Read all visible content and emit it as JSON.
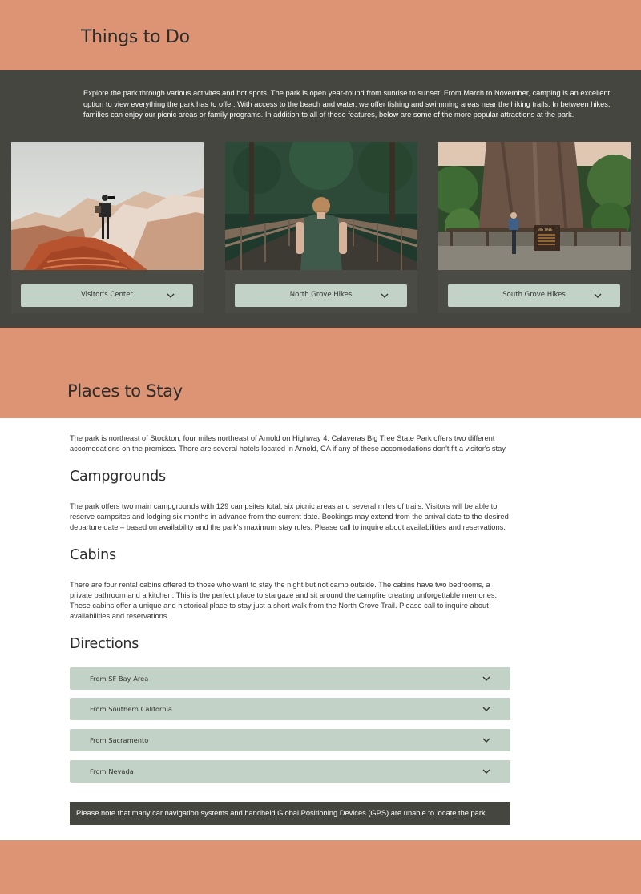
{
  "things": {
    "title": "Things to Do",
    "intro": "Explore the park through various activites and hot spots. The park is open year-round from sunrise to sunset. From March to November, camping is an excellent option to view everything the park has to offer. With access to the beach and water, we offer fishing and swimming areas near the hiking trails. In between hikes, families can enjoy our picnic areas or family programs. In addition to all of these features, below are some of the more popular attractions at the park.",
    "cards": [
      {
        "label": "Visitor's Center",
        "icon": "chevron-down-icon"
      },
      {
        "label": "North Grove Hikes",
        "icon": "chevron-down-icon"
      },
      {
        "label": "South Grove Hikes",
        "icon": "chevron-down-icon"
      }
    ],
    "sign_text": "BIG TREE"
  },
  "places": {
    "title": "Places to Stay",
    "intro": "The park is northeast of Stockton, four miles northeast of Arnold on Highway 4. Calaveras Big Tree State Park offers two different accomodations on the premises. There are several hotels located in Arnold, CA if any of these accomodations don't fit a visitor's stay.",
    "campgrounds": {
      "heading": "Campgrounds",
      "text": "The park offers two main campgrounds with 129 campsites total, six picnic areas and several miles of trails. Visitors will be able to reserve campsites and lodging six months in advance from the current date. Bookings may extend from the arrival date to the desired departure date – based on availability and the park's maximum stay rules. Please call to inquire about availabilities and reservations."
    },
    "cabins": {
      "heading": "Cabins",
      "text": "There are four rental cabins offered to those who want to stay the night but not camp outside. The cabins have two bedrooms, a private bathroom and a kitchen. This is the perfect place to stargaze and sit around the campfire creating unforgettable memories. These cabins offer a unique and historical place to stay just a short walk from the North Grove Trail. Please call to inquire about availabilities and reservations."
    },
    "directions": {
      "heading": "Directions",
      "items": [
        {
          "label": "From SF Bay Area"
        },
        {
          "label": "From Southern California"
        },
        {
          "label": "From Sacramento"
        },
        {
          "label": "From Nevada"
        }
      ],
      "note": "Please note that many car navigation systems and handheld Global Positioning Devices (GPS) are unable to locate the park."
    }
  },
  "colors": {
    "accent_orange": "#dc9474",
    "dark_band": "#454640",
    "button_sage": "#c3d2c6"
  }
}
